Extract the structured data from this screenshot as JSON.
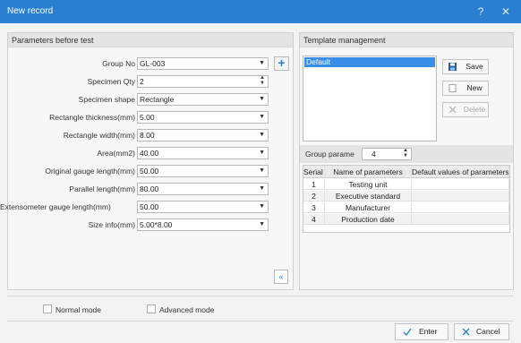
{
  "window": {
    "title": "New record",
    "help_glyph": "?",
    "close_glyph": "✕"
  },
  "left_panel": {
    "title": "Parameters before test",
    "fields": [
      {
        "label": "Group No",
        "value": "GL-003",
        "kind": "combo"
      },
      {
        "label": "Specimen Qty",
        "value": "2",
        "kind": "spin"
      },
      {
        "label": "Specimen shape",
        "value": "Rectangle",
        "kind": "combo"
      },
      {
        "label": "Rectangle thickness(mm)",
        "value": "5.00",
        "kind": "combo"
      },
      {
        "label": "Rectangle width(mm)",
        "value": "8.00",
        "kind": "combo"
      },
      {
        "label": "Area(mm2)",
        "value": "40.00",
        "kind": "combo"
      },
      {
        "label": "Original gauge length(mm)",
        "value": "50.00",
        "kind": "combo"
      },
      {
        "label": "Parallel length(mm)",
        "value": "80.00",
        "kind": "combo"
      },
      {
        "label": "Extensometer gauge length(mm)",
        "value": "50.00",
        "kind": "combo"
      },
      {
        "label": "Size info(mm)",
        "value": "5.00*8.00",
        "kind": "combo"
      }
    ],
    "add_glyph": "+",
    "collapse_glyph": "«"
  },
  "right_panel": {
    "title": "Template management",
    "templates": [
      "Default"
    ],
    "buttons": {
      "save": "Save",
      "new": "New",
      "delete": "Delete"
    },
    "group_params": {
      "label": "Group parame",
      "value": "4"
    },
    "table": {
      "headers": [
        "Serial number",
        "Name of parameters",
        "Default values of parameters"
      ],
      "rows": [
        [
          "1",
          "Testing unit",
          ""
        ],
        [
          "2",
          "Executive standard",
          ""
        ],
        [
          "3",
          "Manufacturer",
          ""
        ],
        [
          "4",
          "Production date",
          ""
        ]
      ]
    }
  },
  "modes": {
    "normal": "Normal mode",
    "advanced": "Advanced mode"
  },
  "footer": {
    "enter": "Enter",
    "cancel": "Cancel"
  },
  "colors": {
    "title_bar": "#2b7fd1",
    "selection": "#3a8ee6",
    "accent": "#2b7fd1"
  }
}
